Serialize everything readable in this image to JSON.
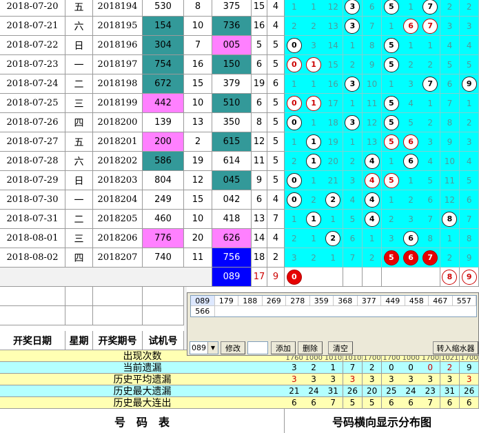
{
  "rows": [
    {
      "date": "2018-07-20",
      "wk": "五",
      "issue": "2018194",
      "test": "530",
      "tsum": "8",
      "open": "375",
      "osum": "15",
      "ospan": "4",
      "test_hl": "",
      "open_hl": "",
      "dist": [
        {
          "t": "1"
        },
        {
          "t": "1"
        },
        {
          "t": "12"
        },
        {
          "t": "3",
          "b": "w"
        },
        {
          "t": "6"
        },
        {
          "t": "5",
          "b": "w"
        },
        {
          "t": "1"
        },
        {
          "t": "7",
          "b": "w"
        },
        {
          "t": "2"
        },
        {
          "t": "2"
        }
      ]
    },
    {
      "date": "2018-07-21",
      "wk": "六",
      "issue": "2018195",
      "test": "154",
      "tsum": "10",
      "open": "736",
      "osum": "16",
      "ospan": "4",
      "test_hl": "teal",
      "open_hl": "teal",
      "dist": [
        {
          "t": "2"
        },
        {
          "t": "2"
        },
        {
          "t": "13"
        },
        {
          "t": "3",
          "b": "w"
        },
        {
          "t": "7"
        },
        {
          "t": "1"
        },
        {
          "t": "6",
          "b": "r"
        },
        {
          "t": "7",
          "b": "r"
        },
        {
          "t": "3"
        },
        {
          "t": "3"
        }
      ]
    },
    {
      "date": "2018-07-22",
      "wk": "日",
      "issue": "2018196",
      "test": "304",
      "tsum": "7",
      "open": "005",
      "osum": "5",
      "ospan": "5",
      "test_hl": "teal",
      "open_hl": "pink",
      "dist": [
        {
          "t": "0",
          "b": "w"
        },
        {
          "t": "3"
        },
        {
          "t": "14"
        },
        {
          "t": "1"
        },
        {
          "t": "8"
        },
        {
          "t": "5",
          "b": "w"
        },
        {
          "t": "1"
        },
        {
          "t": "1"
        },
        {
          "t": "4"
        },
        {
          "t": "4"
        }
      ]
    },
    {
      "date": "2018-07-23",
      "wk": "一",
      "issue": "2018197",
      "test": "754",
      "tsum": "16",
      "open": "150",
      "osum": "6",
      "ospan": "5",
      "test_hl": "teal",
      "open_hl": "teal",
      "dist": [
        {
          "t": "0",
          "b": "r"
        },
        {
          "t": "1",
          "b": "r"
        },
        {
          "t": "15"
        },
        {
          "t": "2"
        },
        {
          "t": "9"
        },
        {
          "t": "5",
          "b": "w"
        },
        {
          "t": "2"
        },
        {
          "t": "2"
        },
        {
          "t": "5"
        },
        {
          "t": "5"
        }
      ]
    },
    {
      "date": "2018-07-24",
      "wk": "二",
      "issue": "2018198",
      "test": "672",
      "tsum": "15",
      "open": "379",
      "osum": "19",
      "ospan": "6",
      "test_hl": "teal",
      "open_hl": "",
      "dist": [
        {
          "t": "1"
        },
        {
          "t": "1"
        },
        {
          "t": "16"
        },
        {
          "t": "3",
          "b": "w"
        },
        {
          "t": "10"
        },
        {
          "t": "1"
        },
        {
          "t": "3"
        },
        {
          "t": "7",
          "b": "w"
        },
        {
          "t": "6"
        },
        {
          "t": "9",
          "b": "w"
        }
      ]
    },
    {
      "date": "2018-07-25",
      "wk": "三",
      "issue": "2018199",
      "test": "442",
      "tsum": "10",
      "open": "510",
      "osum": "6",
      "ospan": "5",
      "test_hl": "pink",
      "open_hl": "teal",
      "dist": [
        {
          "t": "0",
          "b": "r"
        },
        {
          "t": "1",
          "b": "r"
        },
        {
          "t": "17"
        },
        {
          "t": "1"
        },
        {
          "t": "11"
        },
        {
          "t": "5",
          "b": "w"
        },
        {
          "t": "4"
        },
        {
          "t": "1"
        },
        {
          "t": "7"
        },
        {
          "t": "1"
        }
      ]
    },
    {
      "date": "2018-07-26",
      "wk": "四",
      "issue": "2018200",
      "test": "139",
      "tsum": "13",
      "open": "350",
      "osum": "8",
      "ospan": "5",
      "test_hl": "",
      "open_hl": "",
      "dist": [
        {
          "t": "0",
          "b": "w"
        },
        {
          "t": "1"
        },
        {
          "t": "18"
        },
        {
          "t": "3",
          "b": "w"
        },
        {
          "t": "12"
        },
        {
          "t": "5",
          "b": "w"
        },
        {
          "t": "5"
        },
        {
          "t": "2"
        },
        {
          "t": "8"
        },
        {
          "t": "2"
        }
      ]
    },
    {
      "date": "2018-07-27",
      "wk": "五",
      "issue": "2018201",
      "test": "200",
      "tsum": "2",
      "open": "615",
      "osum": "12",
      "ospan": "5",
      "test_hl": "pink",
      "open_hl": "teal",
      "dist": [
        {
          "t": "1"
        },
        {
          "t": "1",
          "b": "w"
        },
        {
          "t": "19"
        },
        {
          "t": "1"
        },
        {
          "t": "13"
        },
        {
          "t": "5",
          "b": "r"
        },
        {
          "t": "6",
          "b": "r"
        },
        {
          "t": "3"
        },
        {
          "t": "9"
        },
        {
          "t": "3"
        }
      ]
    },
    {
      "date": "2018-07-28",
      "wk": "六",
      "issue": "2018202",
      "test": "586",
      "tsum": "19",
      "open": "614",
      "osum": "11",
      "ospan": "5",
      "test_hl": "teal",
      "open_hl": "",
      "dist": [
        {
          "t": "2"
        },
        {
          "t": "1",
          "b": "w"
        },
        {
          "t": "20"
        },
        {
          "t": "2"
        },
        {
          "t": "4",
          "b": "w"
        },
        {
          "t": "1"
        },
        {
          "t": "6",
          "b": "w"
        },
        {
          "t": "4"
        },
        {
          "t": "10"
        },
        {
          "t": "4"
        }
      ]
    },
    {
      "date": "2018-07-29",
      "wk": "日",
      "issue": "2018203",
      "test": "804",
      "tsum": "12",
      "open": "045",
      "osum": "9",
      "ospan": "5",
      "test_hl": "",
      "open_hl": "teal",
      "dist": [
        {
          "t": "0",
          "b": "w"
        },
        {
          "t": "1"
        },
        {
          "t": "21"
        },
        {
          "t": "3"
        },
        {
          "t": "4",
          "b": "r"
        },
        {
          "t": "5",
          "b": "r"
        },
        {
          "t": "1"
        },
        {
          "t": "5"
        },
        {
          "t": "11"
        },
        {
          "t": "5"
        }
      ]
    },
    {
      "date": "2018-07-30",
      "wk": "一",
      "issue": "2018204",
      "test": "249",
      "tsum": "15",
      "open": "042",
      "osum": "6",
      "ospan": "4",
      "test_hl": "",
      "open_hl": "",
      "dist": [
        {
          "t": "0",
          "b": "w"
        },
        {
          "t": "2"
        },
        {
          "t": "2",
          "b": "w"
        },
        {
          "t": "4"
        },
        {
          "t": "4",
          "b": "w"
        },
        {
          "t": "1"
        },
        {
          "t": "2"
        },
        {
          "t": "6"
        },
        {
          "t": "12"
        },
        {
          "t": "6"
        }
      ]
    },
    {
      "date": "2018-07-31",
      "wk": "二",
      "issue": "2018205",
      "test": "460",
      "tsum": "10",
      "open": "418",
      "osum": "13",
      "ospan": "7",
      "test_hl": "",
      "open_hl": "",
      "dist": [
        {
          "t": "1"
        },
        {
          "t": "1",
          "b": "w"
        },
        {
          "t": "1"
        },
        {
          "t": "5"
        },
        {
          "t": "4",
          "b": "w"
        },
        {
          "t": "2"
        },
        {
          "t": "3"
        },
        {
          "t": "7"
        },
        {
          "t": "8",
          "b": "w"
        },
        {
          "t": "7"
        }
      ]
    },
    {
      "date": "2018-08-01",
      "wk": "三",
      "issue": "2018206",
      "test": "776",
      "tsum": "20",
      "open": "626",
      "osum": "14",
      "ospan": "4",
      "test_hl": "pink",
      "open_hl": "pink",
      "dist": [
        {
          "t": "2"
        },
        {
          "t": "1"
        },
        {
          "t": "2",
          "b": "w"
        },
        {
          "t": "6"
        },
        {
          "t": "1"
        },
        {
          "t": "3"
        },
        {
          "t": "6",
          "b": "w"
        },
        {
          "t": "8"
        },
        {
          "t": "1"
        },
        {
          "t": "8"
        }
      ]
    },
    {
      "date": "2018-08-02",
      "wk": "四",
      "issue": "2018207",
      "test": "740",
      "tsum": "11",
      "open": "756",
      "osum": "18",
      "ospan": "2",
      "test_hl": "",
      "open_hl": "blue",
      "dist": [
        {
          "t": "3"
        },
        {
          "t": "2"
        },
        {
          "t": "1"
        },
        {
          "t": "7"
        },
        {
          "t": "2"
        },
        {
          "t": "5",
          "b": "s"
        },
        {
          "t": "6",
          "b": "s"
        },
        {
          "t": "7",
          "b": "s"
        },
        {
          "t": "2"
        },
        {
          "t": "9"
        }
      ]
    }
  ],
  "forecast": {
    "open": "089",
    "osum": "17",
    "ospan": "9",
    "dist": [
      {
        "t": "0",
        "b": "s"
      },
      {
        "t": ""
      },
      {
        "t": ""
      },
      {
        "t": ""
      },
      {
        "t": ""
      },
      {
        "t": ""
      },
      {
        "t": ""
      },
      {
        "t": ""
      },
      {
        "t": "8",
        "b": "r"
      },
      {
        "t": "9",
        "b": "r"
      }
    ]
  },
  "headers": {
    "date": "开奖日期",
    "wk": "星期",
    "issue": "开奖期号",
    "test": "试机号"
  },
  "popup": {
    "row1": [
      "089",
      "179",
      "188",
      "269",
      "278",
      "359",
      "368",
      "377",
      "449",
      "458",
      "467",
      "557"
    ],
    "row2": [
      "566"
    ],
    "select_value": "089",
    "btn_modify": "修改",
    "btn_add": "添加",
    "btn_delete": "删除",
    "btn_clear": "清空",
    "btn_shrink": "转入缩水器"
  },
  "stats": [
    {
      "label": "出现次数",
      "values": [
        "",
        "",
        "",
        "",
        "",
        "",
        "",
        "",
        "",
        ""
      ],
      "colors": []
    },
    {
      "label": "当前遗漏",
      "values": [
        "3",
        "2",
        "1",
        "7",
        "2",
        "0",
        "0",
        "0",
        "2",
        "9"
      ],
      "colors": [
        "#000",
        "#000",
        "#000",
        "#000",
        "#000",
        "#000",
        "#000",
        "#cc0000",
        "#cc0000",
        "#000"
      ]
    },
    {
      "label": "历史平均遗漏",
      "values": [
        "3",
        "3",
        "3",
        "3",
        "3",
        "3",
        "3",
        "3",
        "3",
        "3"
      ],
      "colors": [
        "#cc0000",
        "#000",
        "#000",
        "#cc0000",
        "#000",
        "#000",
        "#000",
        "#000",
        "#000",
        "#cc0000"
      ]
    },
    {
      "label": "历史最大遗漏",
      "values": [
        "21",
        "24",
        "31",
        "26",
        "20",
        "25",
        "24",
        "23",
        "31",
        "26"
      ],
      "colors": []
    },
    {
      "label": "历史最大连出",
      "values": [
        "6",
        "6",
        "7",
        "5",
        "5",
        "6",
        "6",
        "7",
        "6",
        "6"
      ],
      "colors": []
    }
  ],
  "stats_partial_top": [
    "1760",
    "1000",
    "1010",
    "1010",
    "1700",
    "1700",
    "1000",
    "1700",
    "1021",
    "1700"
  ],
  "footer": {
    "left": "号　码　表",
    "right": "号码横向显示分布图"
  }
}
